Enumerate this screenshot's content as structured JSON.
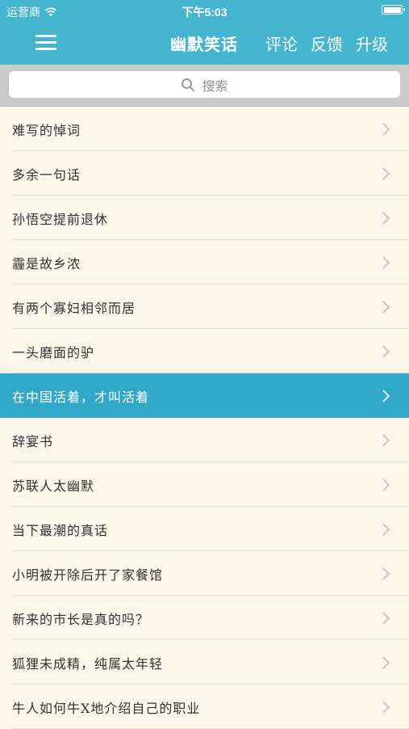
{
  "status_bar": {
    "carrier": "运营商",
    "time": "下午5:03"
  },
  "nav": {
    "title": "幽默笑话",
    "links": [
      "评论",
      "反馈",
      "升级"
    ]
  },
  "search": {
    "placeholder": "搜索"
  },
  "items": [
    "难写的悼词",
    "多余一句话",
    "孙悟空提前退休",
    "霾是故乡浓",
    "有两个寡妇相邻而居",
    "一头磨面的驴",
    "在中国活着，才叫活着",
    "辞宴书",
    "苏联人太幽默",
    "当下最潮的真话",
    "小明被开除后开了家餐馆",
    "新来的市长是真的吗？",
    "狐狸未成精，纯属太年轻",
    "牛人如何牛X地介绍自己的职业"
  ],
  "selected_index": 6,
  "colors": {
    "accent": "#45b5cf",
    "selected_row": "#31a8c6",
    "list_background": "#fbf5ea",
    "search_bar_background": "#cacaca"
  }
}
